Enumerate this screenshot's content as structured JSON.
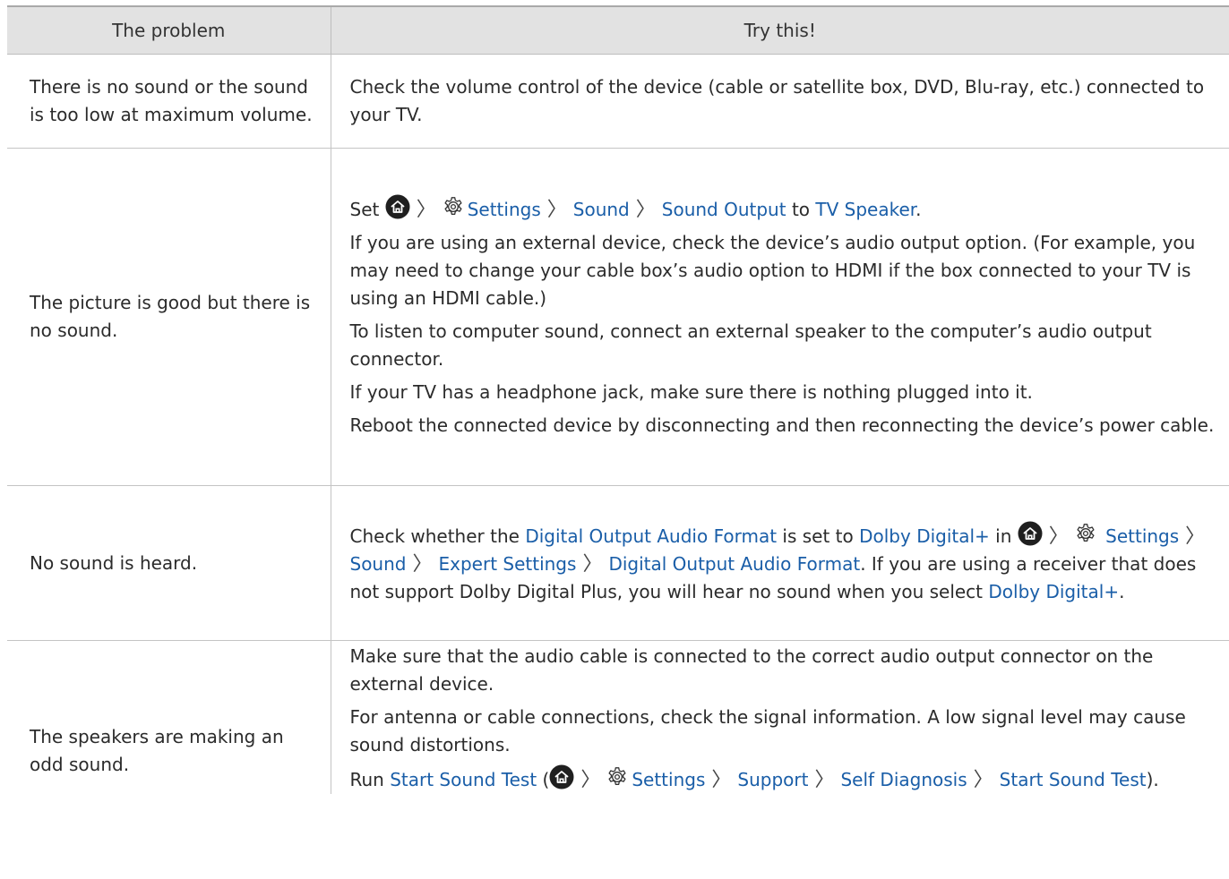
{
  "header": {
    "problem": "The problem",
    "try": "Try this!"
  },
  "rows": [
    {
      "problem": "There is no sound or the sound is too low at maximum volume.",
      "solution": "Check the volume control of the device (cable or satellite box, DVD, Blu-ray, etc.) connected to your TV."
    },
    {
      "problem": "The picture is good but there is no sound.",
      "set_prefix": "Set",
      "path1": [
        "Settings",
        "Sound",
        "Sound Output"
      ],
      "to": "to",
      "path1_target": "TV Speaker",
      "period": ".",
      "tips": [
        "If you are using an external device, check the device’s audio output option. (For example, you may need to change your cable box’s audio option to HDMI if the box connected to your TV is using an HDMI cable.)",
        "To listen to computer sound, connect an external speaker to the computer’s audio output connector.",
        "If your TV has a headphone jack, make sure there is nothing plugged into it.",
        "Reboot the connected device by disconnecting and then reconnecting the device’s power cable."
      ]
    },
    {
      "problem": "No sound is heard.",
      "check_prefix": "Check whether the",
      "format_link": "Digital Output Audio Format",
      "is_set_to": "is set to",
      "dolby_link": "Dolby Digital+",
      "in": "in",
      "path2": [
        "Settings",
        "Sound",
        "Expert Settings",
        "Digital Output Audio Format"
      ],
      "rest": ". If you are using a receiver that does not support Dolby Digital Plus, you will hear no sound when you select",
      "dolby_link2": "Dolby Digital+",
      "period": "."
    },
    {
      "problem": "The speakers are making an odd sound.",
      "tip1": "Make sure that the audio cable is connected to the correct audio output connector on the external device.",
      "tip2": "For antenna or cable connections, check the signal information. A low signal level may cause sound distortions.",
      "run": "Run",
      "run_link": "Start Sound Test",
      "open_paren": "(",
      "path3": [
        "Settings",
        "Support",
        "Self Diagnosis",
        "Start Sound Test"
      ],
      "close": ")."
    }
  ],
  "icons": {
    "home": "home-icon",
    "gear": "gear-icon",
    "separator": "chevron-right-icon"
  },
  "colors": {
    "link": "#1a5ea8",
    "header_bg": "#e2e2e2"
  }
}
